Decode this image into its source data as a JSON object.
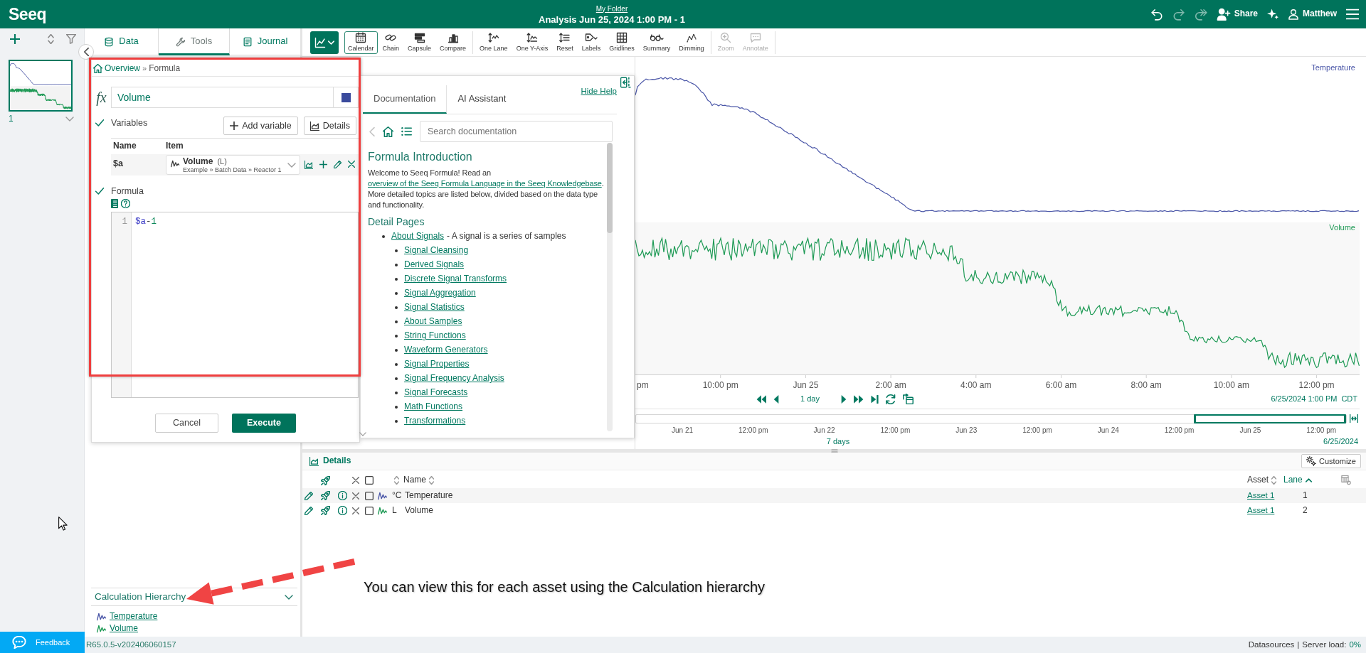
{
  "header": {
    "logo": "Seeq",
    "folder": "My Folder",
    "title": "Analysis Jun 25, 2024 1:00 PM - 1",
    "history": [
      {
        "disabled": false
      },
      {
        "disabled": true
      },
      {
        "disabled": true
      }
    ],
    "share": "Share",
    "user": "Matthew"
  },
  "worksheets": {
    "items": [
      {
        "label": "1",
        "selected": true
      }
    ]
  },
  "tools_panel": {
    "tabs": [
      {
        "label": "Data",
        "selected": false
      },
      {
        "label": "Tools",
        "selected": true
      },
      {
        "label": "Journal",
        "selected": false
      }
    ],
    "calculation_hierarchy": {
      "title": "Calculation Hierarchy",
      "expanded": true,
      "items": [
        {
          "label": "Temperature",
          "color": "#4b57a8"
        },
        {
          "label": "Volume",
          "color": "#1e9a55"
        }
      ]
    }
  },
  "toolbar": {
    "groups": [
      [
        {
          "label": "Calendar",
          "selected": true,
          "disabled": false
        },
        {
          "label": "Chain",
          "selected": false,
          "disabled": false
        },
        {
          "label": "Capsule",
          "selected": false,
          "disabled": false
        },
        {
          "label": "Compare",
          "selected": false,
          "disabled": false
        }
      ],
      [
        {
          "label": "One Lane",
          "selected": false,
          "disabled": false
        },
        {
          "label": "One Y-Axis",
          "selected": false,
          "disabled": false
        },
        {
          "label": "Reset",
          "selected": false,
          "disabled": false
        },
        {
          "label": "Labels",
          "selected": false,
          "disabled": false
        },
        {
          "label": "Gridlines",
          "selected": false,
          "disabled": false
        },
        {
          "label": "Summary",
          "selected": false,
          "disabled": false
        },
        {
          "label": "Dimming",
          "selected": false,
          "disabled": false
        }
      ],
      [
        {
          "label": "Zoom",
          "selected": false,
          "disabled": true
        },
        {
          "label": "Annotate",
          "selected": false,
          "disabled": true
        }
      ]
    ]
  },
  "formula_tool": {
    "breadcrumb": [
      "Overview",
      "Formula"
    ],
    "breadcrumb_separator": "»",
    "symbol": "fx",
    "name": "Volume",
    "color": "#3a4a9c",
    "variables": {
      "label": "Variables",
      "complete": true,
      "add_label": "Add variable",
      "details_label": "Details",
      "columns": [
        "Name",
        "Item"
      ],
      "rows": [
        {
          "name": "$a",
          "item": "Volume",
          "unit": "(L)",
          "path": "Example » Batch Data » Reactor 1"
        }
      ]
    },
    "formula": {
      "label": "Formula",
      "complete": true,
      "lines": [
        {
          "number": "1",
          "tokens": [
            {
              "kind": "variable",
              "text": "$a"
            },
            {
              "kind": "operator",
              "text": "-"
            },
            {
              "kind": "number",
              "text": "1"
            }
          ]
        }
      ]
    },
    "buttons": [
      {
        "label": "Cancel",
        "kind": "secondary"
      },
      {
        "label": "Execute",
        "kind": "primary"
      }
    ]
  },
  "help_panel": {
    "tabs": [
      {
        "label": "Documentation",
        "selected": true
      },
      {
        "label": "AI Assistant",
        "selected": false
      }
    ],
    "hide_link": "Hide Help",
    "back_disabled": true,
    "search_placeholder": "Search documentation",
    "title": "Formula Introduction",
    "intro": {
      "before": "Welcome to Seeq Formula! Read an ",
      "link": "overview of the Seeq Formula Language in the Seeq Knowledgebase",
      "after": ". More detailed topics are listed below, divided based on the data type and functionality."
    },
    "subtitle": "Detail Pages",
    "topics": [
      {
        "label": "About Signals",
        "description": "- A signal is a series of samples",
        "children": [
          {
            "label": "Signal Cleansing"
          },
          {
            "label": "Derived Signals"
          },
          {
            "label": "Discrete Signal Transforms"
          },
          {
            "label": "Signal Aggregation"
          },
          {
            "label": "Signal Statistics"
          },
          {
            "label": "About Samples"
          },
          {
            "label": "String Functions"
          },
          {
            "label": "Waveform Generators"
          },
          {
            "label": "Signal Properties"
          },
          {
            "label": "Signal Frequency Analysis"
          },
          {
            "label": "Signal Forecasts"
          },
          {
            "label": "Math Functions"
          },
          {
            "label": "Transformations"
          }
        ]
      }
    ]
  },
  "trend": {
    "lanes": [
      {
        "label": "Temperature",
        "color": "#4b57a8"
      },
      {
        "label": "Volume",
        "color": "#1e9a55"
      }
    ],
    "x_labels": [
      "pm",
      "10:00 pm",
      "Jun 25",
      "2:00 am",
      "4:00 am",
      "6:00 am",
      "8:00 am",
      "10:00 am",
      "12:00 pm"
    ],
    "step": "1 day",
    "end": "6/25/2024 1:00 PM",
    "timezone": "CDT",
    "navigator_labels": [
      "Jun 21",
      "12:00 pm",
      "Jun 22",
      "12:00 pm",
      "Jun 23",
      "12:00 pm",
      "Jun 24",
      "12:00 pm",
      "Jun 25",
      "12:00 pm"
    ],
    "navigator_span": "7 days",
    "navigator_end": "6/25/2024"
  },
  "details": {
    "title": "Details",
    "customize": "Customize",
    "all_selected": false,
    "unit_sorted": false,
    "columns": [
      {
        "label": "Name",
        "sorted": false
      },
      {
        "label": "Asset",
        "sorted": false
      },
      {
        "label": "Lane",
        "sorted": true
      }
    ],
    "rows": [
      {
        "unit": "°C",
        "name": "Temperature",
        "asset": "Asset 1",
        "lane": "1",
        "color": "#4b57a8",
        "selected": false
      },
      {
        "unit": "L",
        "name": "Volume",
        "asset": "Asset 1",
        "lane": "2",
        "color": "#1e9a55",
        "selected": false
      }
    ]
  },
  "annotation": "You can view this for each asset using the Calculation hierarchy",
  "status_bar": {
    "version": "R65.0.5-v202406060157",
    "datasources": "Datasources",
    "separator": "|",
    "server_load_label": "Server load:",
    "server_load": "0%"
  },
  "feedback": "Feedback"
}
